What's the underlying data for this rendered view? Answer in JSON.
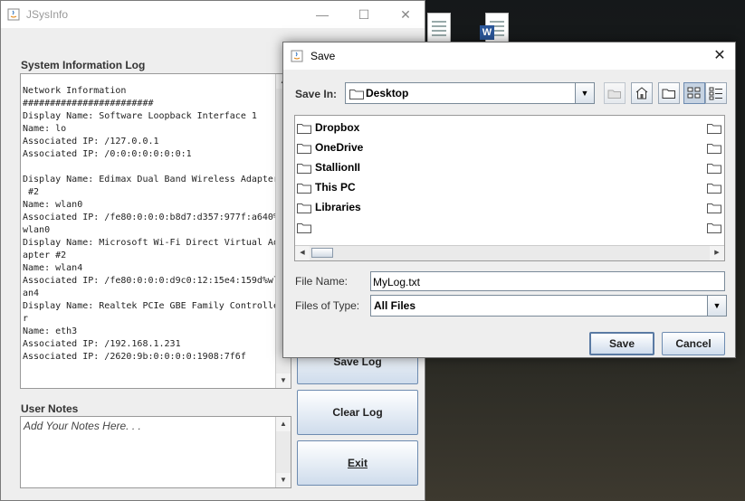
{
  "main_window": {
    "title": "JSysInfo",
    "minimize": "—",
    "maximize": "☐",
    "close": "✕",
    "log_label": "System Information Log",
    "log_text": "Network Information\n########################\nDisplay Name: Software Loopback Interface 1\nName: lo\nAssociated IP: /127.0.0.1\nAssociated IP: /0:0:0:0:0:0:0:1\n\nDisplay Name: Edimax Dual Band Wireless Adapter\n #2\nName: wlan0\nAssociated IP: /fe80:0:0:0:b8d7:d357:977f:a640%\nwlan0\nDisplay Name: Microsoft Wi-Fi Direct Virtual Ad\napter #2\nName: wlan4\nAssociated IP: /fe80:0:0:0:d9c0:12:15e4:159d%wl\nan4\nDisplay Name: Realtek PCIe GBE Family Controlle\nr\nName: eth3\nAssociated IP: /192.168.1.231\nAssociated IP: /2620:9b:0:0:0:0:1908:7f6f",
    "notes_label": "User Notes",
    "notes_placeholder": "Add Your Notes Here. . .",
    "buttons": {
      "save_log": "Save Log",
      "clear_log": "Clear Log",
      "exit": "Exit"
    },
    "scroll_up": "▲",
    "scroll_down": "▼"
  },
  "save_dialog": {
    "title": "Save",
    "close": "✕",
    "save_in_label": "Save In:",
    "save_in_value": "Desktop",
    "combo_arrow": "▼",
    "toolbar_icons": [
      "up-one-level-icon",
      "home-icon",
      "new-folder-icon",
      "list-view-icon",
      "details-view-icon"
    ],
    "files": [
      "Dropbox",
      "OneDrive",
      "StallionII",
      "This PC",
      "Libraries",
      ""
    ],
    "scroll_left": "◀",
    "scroll_right": "▶",
    "file_name_label": "File Name:",
    "file_name_value": "MyLog.txt",
    "files_of_type_label": "Files of Type:",
    "files_of_type_value": "All Files",
    "save_button": "Save",
    "cancel_button": "Cancel"
  },
  "colors": {
    "button_border": "#6d8bb0",
    "window_bg": "#eeeeee"
  }
}
